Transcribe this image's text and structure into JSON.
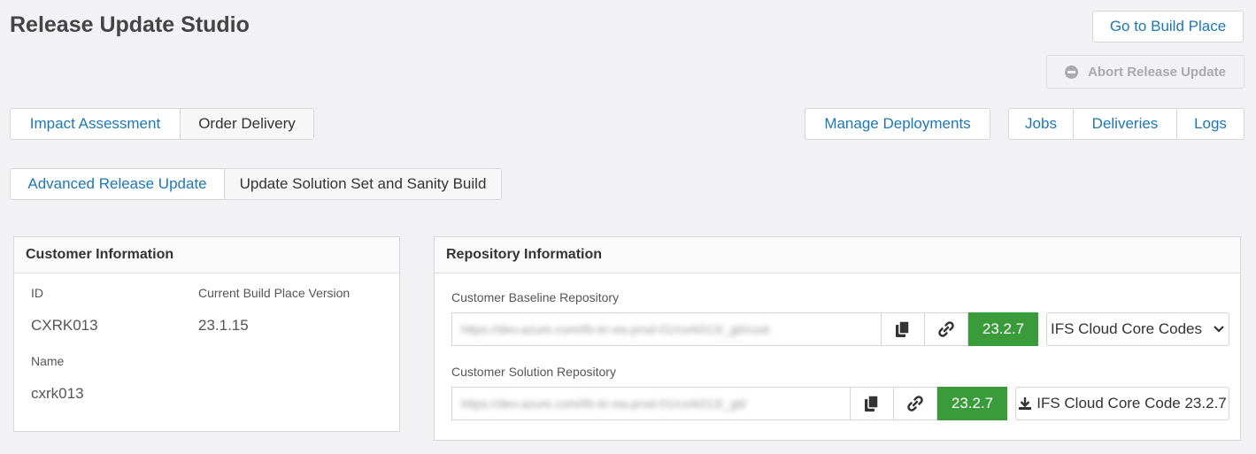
{
  "header": {
    "title": "Release Update Studio",
    "go_to_build_place": "Go to Build Place",
    "abort_release_update": "Abort Release Update"
  },
  "tabs_row1": {
    "left": [
      "Impact Assessment",
      "Order Delivery"
    ],
    "manage_deployments": "Manage Deployments",
    "right": [
      "Jobs",
      "Deliveries",
      "Logs"
    ]
  },
  "tabs_row2": [
    "Advanced Release Update",
    "Update Solution Set and Sanity Build"
  ],
  "customer": {
    "heading": "Customer Information",
    "id_label": "ID",
    "id_value": "CXRK013",
    "version_label": "Current Build Place Version",
    "version_value": "23.1.15",
    "name_label": "Name",
    "name_value": "cxrk013"
  },
  "repository": {
    "heading": "Repository Information",
    "baseline": {
      "label": "Customer Baseline Repository",
      "url_blurred": "https://dev.azure.com/ifs-kr-ea-prsd-01/cxrk013/_git/cust",
      "version": "23.2.7",
      "dropdown": "IFS Cloud Core Codes"
    },
    "solution": {
      "label": "Customer Solution Repository",
      "url_blurred": "https://dev.azure.com/ifs-kr-ea-prsd-01/cxrk013/_git/",
      "version": "23.2.7",
      "download": "IFS Cloud Core Code 23.2.7"
    }
  },
  "colors": {
    "accent": "#1d77b6",
    "version_green": "#3a9b3a",
    "background": "#f2f1f3"
  }
}
